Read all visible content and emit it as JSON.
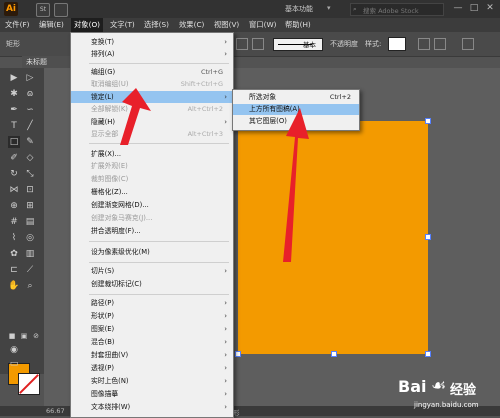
{
  "app": {
    "logo": "Ai",
    "quick_icon_1": "St",
    "workspace": "基本功能",
    "search_placeholder": "搜索 Adobe Stock"
  },
  "window_controls": {
    "minimize": "—",
    "maximize": "□",
    "close": "✕"
  },
  "menubar": [
    {
      "label": "文件(F)"
    },
    {
      "label": "编辑(E)"
    },
    {
      "label": "对象(O)"
    },
    {
      "label": "文字(T)"
    },
    {
      "label": "选择(S)"
    },
    {
      "label": "效果(C)"
    },
    {
      "label": "视图(V)"
    },
    {
      "label": "窗口(W)"
    },
    {
      "label": "帮助(H)"
    }
  ],
  "controlbar": {
    "shape_label": "矩形",
    "stroke_weight_label": "基本",
    "opacity_label": "不透明度",
    "style_label": "样式:"
  },
  "document_tab": {
    "label": "未标题"
  },
  "statusbar": {
    "zoom": "66.67",
    "tool": "形"
  },
  "object_menu": {
    "items": [
      {
        "label": "变换(T)",
        "shortcut": "",
        "submenu": true,
        "disabled": false
      },
      {
        "label": "排列(A)",
        "shortcut": "",
        "submenu": true,
        "disabled": false
      },
      {
        "label": "编组(G)",
        "shortcut": "Ctrl+G",
        "submenu": false,
        "disabled": false
      },
      {
        "label": "取消编组(U)",
        "shortcut": "Shift+Ctrl+G",
        "submenu": false,
        "disabled": true
      },
      {
        "label": "锁定(L)",
        "shortcut": "",
        "submenu": true,
        "disabled": false,
        "highlight": true
      },
      {
        "label": "全部解锁(K)",
        "shortcut": "Alt+Ctrl+2",
        "submenu": false,
        "disabled": true
      },
      {
        "label": "隐藏(H)",
        "shortcut": "",
        "submenu": true,
        "disabled": false
      },
      {
        "label": "显示全部",
        "shortcut": "Alt+Ctrl+3",
        "submenu": false,
        "disabled": true
      },
      {
        "label": "扩展(X)...",
        "shortcut": "",
        "submenu": false,
        "disabled": false
      },
      {
        "label": "扩展外观(E)",
        "shortcut": "",
        "submenu": false,
        "disabled": true
      },
      {
        "label": "裁剪图像(C)",
        "shortcut": "",
        "submenu": false,
        "disabled": true
      },
      {
        "label": "栅格化(Z)...",
        "shortcut": "",
        "submenu": false,
        "disabled": false
      },
      {
        "label": "创建渐变网格(D)...",
        "shortcut": "",
        "submenu": false,
        "disabled": false
      },
      {
        "label": "创建对象马赛克(J)...",
        "shortcut": "",
        "submenu": false,
        "disabled": true
      },
      {
        "label": "拼合透明度(F)...",
        "shortcut": "",
        "submenu": false,
        "disabled": false
      },
      {
        "label": "设为像素级优化(M)",
        "shortcut": "",
        "submenu": false,
        "disabled": false
      },
      {
        "label": "切片(S)",
        "shortcut": "",
        "submenu": true,
        "disabled": false
      },
      {
        "label": "创建裁切标记(C)",
        "shortcut": "",
        "submenu": false,
        "disabled": false
      },
      {
        "label": "路径(P)",
        "shortcut": "",
        "submenu": true,
        "disabled": false
      },
      {
        "label": "形状(P)",
        "shortcut": "",
        "submenu": true,
        "disabled": false
      },
      {
        "label": "图案(E)",
        "shortcut": "",
        "submenu": true,
        "disabled": false
      },
      {
        "label": "混合(B)",
        "shortcut": "",
        "submenu": true,
        "disabled": false
      },
      {
        "label": "封套扭曲(V)",
        "shortcut": "",
        "submenu": true,
        "disabled": false
      },
      {
        "label": "透视(P)",
        "shortcut": "",
        "submenu": true,
        "disabled": false
      },
      {
        "label": "实时上色(N)",
        "shortcut": "",
        "submenu": true,
        "disabled": false
      },
      {
        "label": "图像描摹",
        "shortcut": "",
        "submenu": true,
        "disabled": false
      },
      {
        "label": "文本绕排(W)",
        "shortcut": "",
        "submenu": true,
        "disabled": false
      }
    ]
  },
  "lock_submenu": {
    "items": [
      {
        "label": "所选对象",
        "shortcut": "Ctrl+2"
      },
      {
        "label": "上方所有图稿(A)",
        "shortcut": "",
        "highlight": true
      },
      {
        "label": "其它图层(O)",
        "shortcut": ""
      }
    ]
  },
  "watermark": {
    "brand": "Bai",
    "brand2": "经验",
    "url": "jingyan.baidu.com"
  },
  "colors": {
    "fill": "#f39a00",
    "stroke": "#ffffff",
    "accent": "#94c4f0",
    "arrow": "#e8202a"
  }
}
